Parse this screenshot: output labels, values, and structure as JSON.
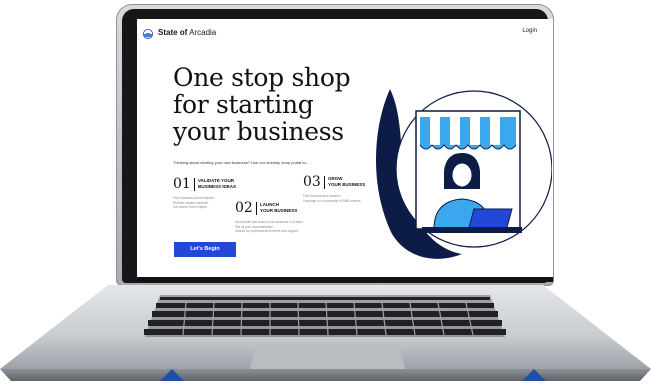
{
  "header": {
    "brand_bold": "State of",
    "brand_rest": "Arcadia",
    "login_label": "Login"
  },
  "hero": {
    "title_lines": [
      "One stop shop",
      "for starting",
      "your business"
    ],
    "intro": "Thinking about starting your own business? Use our onestop shop portal to..."
  },
  "steps": [
    {
      "number": "01",
      "heading_lines": [
        "VALIDATE YOUR",
        "BUSINESS IDEAS"
      ],
      "lines": [
        "Find business plan templates",
        "Perform market research",
        "Get advice from experts"
      ]
    },
    {
      "number": "02",
      "heading_lines": [
        "LAUNCH",
        "YOUR BUSINESS"
      ],
      "lines": [
        "Incorporate and launch your business in 4 steps",
        "File all your documentation",
        "Search for professional services and support"
      ]
    },
    {
      "number": "03",
      "heading_lines": [
        "GROW",
        "YOUR BUSINESS"
      ],
      "lines": [
        "Find mentors and coaches",
        "Leverage our community of SMB owners"
      ]
    }
  ],
  "cta_label": "Let's Begin",
  "icons": {
    "logo": "state-logo-icon",
    "illustration": "shop-owner-illustration"
  },
  "colors": {
    "accent_blue": "#2148d6",
    "awning_blue": "#3aa7ee",
    "dark_navy": "#0d1c47",
    "text_dark": "#111111"
  }
}
